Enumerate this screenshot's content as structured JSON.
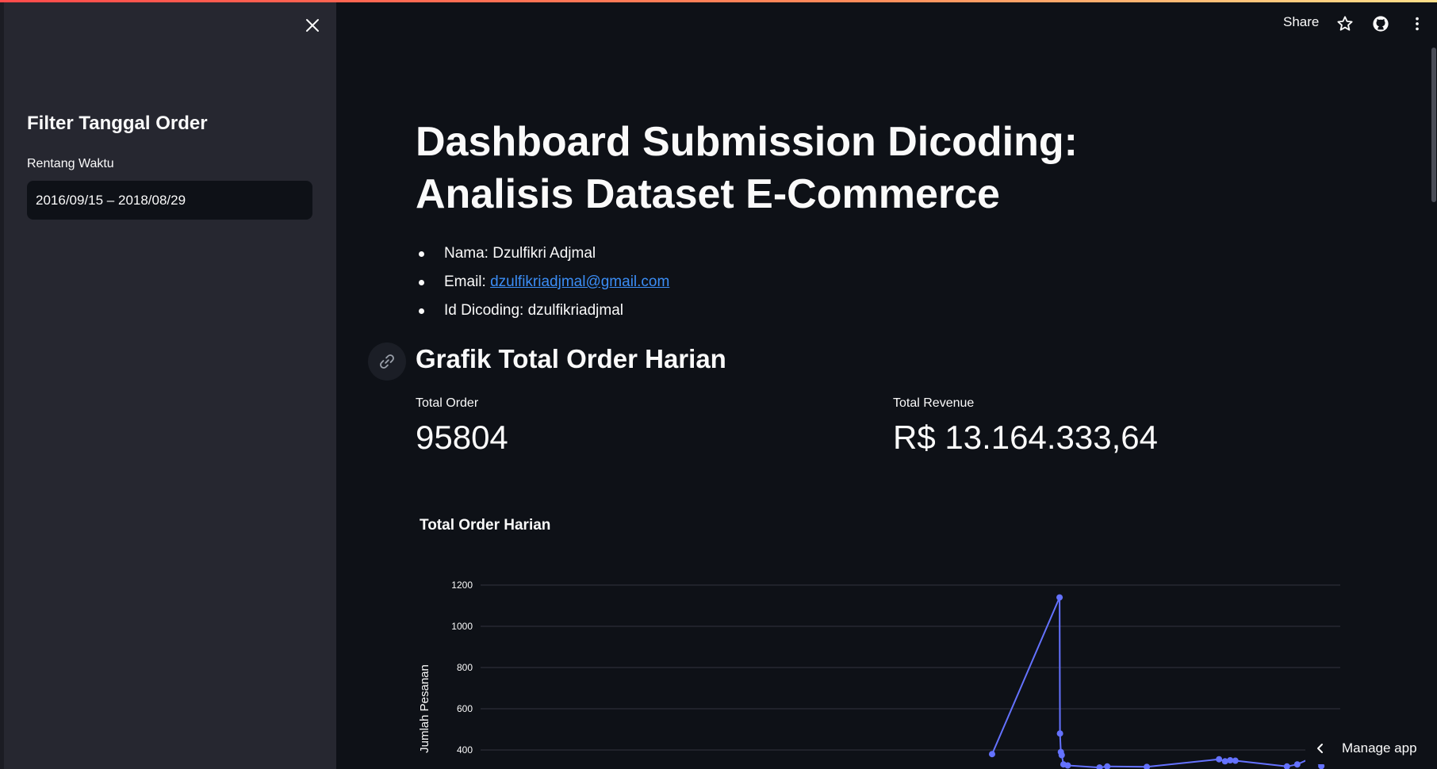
{
  "sidebar": {
    "close_icon": "close-icon",
    "title": "Filter Tanggal Order",
    "range_label": "Rentang Waktu",
    "range_value": "2016/09/15 – 2018/08/29"
  },
  "header": {
    "share_label": "Share",
    "icons": [
      "star-icon",
      "github-icon",
      "more-vertical-icon"
    ]
  },
  "main": {
    "title": "Dashboard Submission Dicoding: Analisis Dataset E-Commerce",
    "info": {
      "name": "Nama: Dzulfikri Adjmal",
      "email_label": "Email: ",
      "email_link": "dzulfikriadjmal@gmail.com",
      "dicoding_id": "Id Dicoding: dzulfikriadjmal"
    },
    "section_title": "Grafik Total Order Harian",
    "metrics": [
      {
        "label": "Total Order",
        "value": "95804"
      },
      {
        "label": "Total Revenue",
        "value": "R$ 13.164.333,64"
      }
    ]
  },
  "chart_data": {
    "type": "line",
    "title": "Total Order Harian",
    "ylabel": "Jumlah Pesanan",
    "xlabel": "",
    "y_ticks": [
      400,
      600,
      800,
      1000,
      1200
    ],
    "y_visible_range": [
      390,
      1300
    ],
    "grid": true,
    "color": "#6472ff",
    "visible_points": [
      {
        "x": 0.595,
        "y": 380
      },
      {
        "x": 0.6735,
        "y": 1140
      },
      {
        "x": 0.674,
        "y": 480
      },
      {
        "x": 0.675,
        "y": 390
      },
      {
        "x": 0.676,
        "y": 375
      },
      {
        "x": 0.678,
        "y": 330
      },
      {
        "x": 0.683,
        "y": 325
      },
      {
        "x": 0.72,
        "y": 315
      },
      {
        "x": 0.729,
        "y": 320
      },
      {
        "x": 0.775,
        "y": 318
      },
      {
        "x": 0.859,
        "y": 355
      },
      {
        "x": 0.866,
        "y": 345
      },
      {
        "x": 0.872,
        "y": 350
      },
      {
        "x": 0.878,
        "y": 348
      },
      {
        "x": 0.938,
        "y": 320
      },
      {
        "x": 0.95,
        "y": 330
      },
      {
        "x": 0.966,
        "y": 360
      },
      {
        "x": 0.978,
        "y": 322
      }
    ]
  },
  "manage_app": {
    "label": "Manage app",
    "icon": "chevron-left-icon"
  }
}
